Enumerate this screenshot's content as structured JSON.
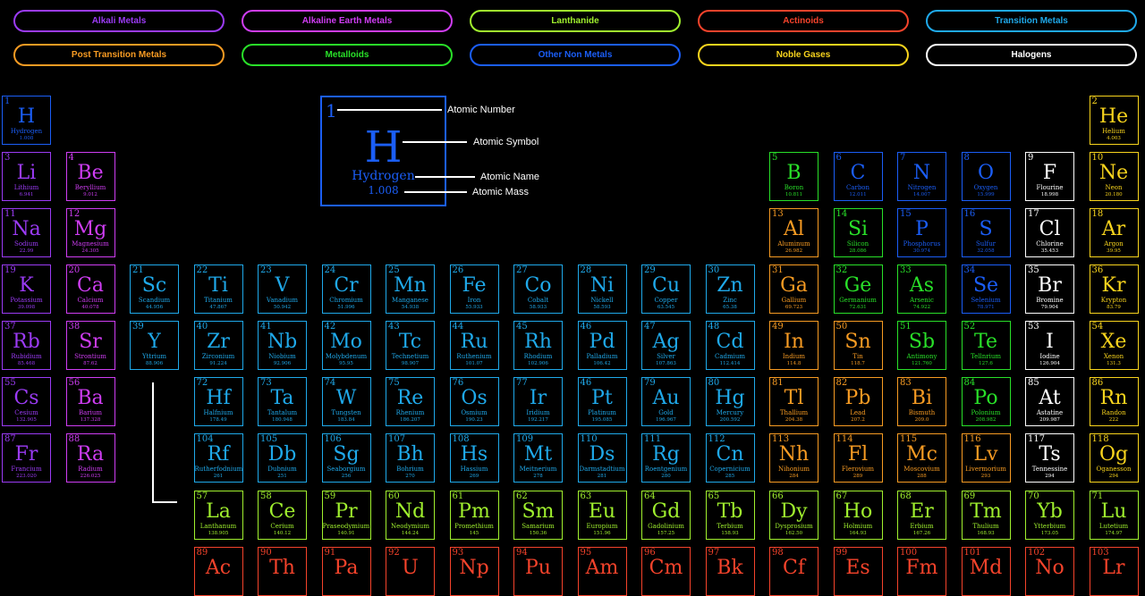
{
  "colors": {
    "alkali": "#9b3bf5",
    "alkaline": "#cf3df3",
    "lanthanide": "#a0f02e",
    "actinoid": "#f5432b",
    "transition": "#1fa9ea",
    "post": "#f79b23",
    "metalloid": "#29e029",
    "nonmetal": "#1b5ef7",
    "noble": "#f8d41d",
    "halogen": "#ffffff"
  },
  "categories": [
    {
      "label": "Alkali Metals",
      "cat": "alkali"
    },
    {
      "label": "Alkaline Earth Metals",
      "cat": "alkaline"
    },
    {
      "label": "Lanthanide",
      "cat": "lanthanide"
    },
    {
      "label": "Actinoids",
      "cat": "actinoid"
    },
    {
      "label": "Transition Metals",
      "cat": "transition"
    },
    {
      "label": "Post Transition Metals",
      "cat": "post"
    },
    {
      "label": "Metalloids",
      "cat": "metalloid"
    },
    {
      "label": "Other Non Metals",
      "cat": "nonmetal"
    },
    {
      "label": "Noble Gases",
      "cat": "noble"
    },
    {
      "label": "Halogens",
      "cat": "halogen"
    }
  ],
  "legend": {
    "number": "1",
    "symbol": "H",
    "name": "Hydrogen",
    "mass": "1.008",
    "labels": {
      "number": "Atomic Number",
      "symbol": "Atomic Symbol",
      "name": "Atomic Name",
      "mass": "Atomic Mass"
    }
  },
  "elements": [
    {
      "n": "1",
      "s": "H",
      "name": "Hydrogen",
      "m": "1.008",
      "c": "nonmetal",
      "col": 1,
      "row": 1
    },
    {
      "n": "2",
      "s": "He",
      "name": "Helium",
      "m": "4.003",
      "c": "noble",
      "col": 18,
      "row": 1
    },
    {
      "n": "3",
      "s": "Li",
      "name": "Lithium",
      "m": "6.941",
      "c": "alkali",
      "col": 1,
      "row": 2
    },
    {
      "n": "4",
      "s": "Be",
      "name": "Beryllium",
      "m": "9.012",
      "c": "alkaline",
      "col": 2,
      "row": 2
    },
    {
      "n": "5",
      "s": "B",
      "name": "Boron",
      "m": "10.811",
      "c": "metalloid",
      "col": 13,
      "row": 2
    },
    {
      "n": "6",
      "s": "C",
      "name": "Carbon",
      "m": "12.011",
      "c": "nonmetal",
      "col": 14,
      "row": 2
    },
    {
      "n": "7",
      "s": "N",
      "name": "Nitrogen",
      "m": "14.007",
      "c": "nonmetal",
      "col": 15,
      "row": 2
    },
    {
      "n": "8",
      "s": "O",
      "name": "Oxygen",
      "m": "15.999",
      "c": "nonmetal",
      "col": 16,
      "row": 2
    },
    {
      "n": "9",
      "s": "F",
      "name": "Flourine",
      "m": "18.998",
      "c": "halogen",
      "col": 17,
      "row": 2
    },
    {
      "n": "10",
      "s": "Ne",
      "name": "Neon",
      "m": "20.180",
      "c": "noble",
      "col": 18,
      "row": 2
    },
    {
      "n": "11",
      "s": "Na",
      "name": "Sodium",
      "m": "22.99",
      "c": "alkali",
      "col": 1,
      "row": 3
    },
    {
      "n": "12",
      "s": "Mg",
      "name": "Magnesium",
      "m": "24.305",
      "c": "alkaline",
      "col": 2,
      "row": 3
    },
    {
      "n": "13",
      "s": "Al",
      "name": "Aluminum",
      "m": "26.982",
      "c": "post",
      "col": 13,
      "row": 3
    },
    {
      "n": "14",
      "s": "Si",
      "name": "Silicon",
      "m": "28.086",
      "c": "metalloid",
      "col": 14,
      "row": 3
    },
    {
      "n": "15",
      "s": "P",
      "name": "Phosphorus",
      "m": "30.974",
      "c": "nonmetal",
      "col": 15,
      "row": 3
    },
    {
      "n": "16",
      "s": "S",
      "name": "Sulfur",
      "m": "32.058",
      "c": "nonmetal",
      "col": 16,
      "row": 3
    },
    {
      "n": "17",
      "s": "Cl",
      "name": "Chlorine",
      "m": "35.453",
      "c": "halogen",
      "col": 17,
      "row": 3
    },
    {
      "n": "18",
      "s": "Ar",
      "name": "Argon",
      "m": "39.95",
      "c": "noble",
      "col": 18,
      "row": 3
    },
    {
      "n": "19",
      "s": "K",
      "name": "Potassium",
      "m": "39.098",
      "c": "alkali",
      "col": 1,
      "row": 4
    },
    {
      "n": "20",
      "s": "Ca",
      "name": "Calcium",
      "m": "40.078",
      "c": "alkaline",
      "col": 2,
      "row": 4
    },
    {
      "n": "21",
      "s": "Sc",
      "name": "Scandium",
      "m": "44.956",
      "c": "transition",
      "col": 3,
      "row": 4
    },
    {
      "n": "22",
      "s": "Ti",
      "name": "Titanium",
      "m": "47.867",
      "c": "transition",
      "col": 4,
      "row": 4
    },
    {
      "n": "23",
      "s": "V",
      "name": "Vanadium",
      "m": "50.942",
      "c": "transition",
      "col": 5,
      "row": 4
    },
    {
      "n": "24",
      "s": "Cr",
      "name": "Chromium",
      "m": "51.996",
      "c": "transition",
      "col": 6,
      "row": 4
    },
    {
      "n": "25",
      "s": "Mn",
      "name": "Manganese",
      "m": "54.938",
      "c": "transition",
      "col": 7,
      "row": 4
    },
    {
      "n": "26",
      "s": "Fe",
      "name": "Iron",
      "m": "55.933",
      "c": "transition",
      "col": 8,
      "row": 4
    },
    {
      "n": "27",
      "s": "Co",
      "name": "Cobalt",
      "m": "58.933",
      "c": "transition",
      "col": 9,
      "row": 4
    },
    {
      "n": "28",
      "s": "Ni",
      "name": "Nickell",
      "m": "58.593",
      "c": "transition",
      "col": 10,
      "row": 4
    },
    {
      "n": "29",
      "s": "Cu",
      "name": "Copper",
      "m": "63.545",
      "c": "transition",
      "col": 11,
      "row": 4
    },
    {
      "n": "30",
      "s": "Zn",
      "name": "Zinc",
      "m": "65.38",
      "c": "transition",
      "col": 12,
      "row": 4
    },
    {
      "n": "31",
      "s": "Ga",
      "name": "Gallium",
      "m": "69.723",
      "c": "post",
      "col": 13,
      "row": 4
    },
    {
      "n": "32",
      "s": "Ge",
      "name": "Germanium",
      "m": "72.631",
      "c": "metalloid",
      "col": 14,
      "row": 4
    },
    {
      "n": "33",
      "s": "As",
      "name": "Arsenic",
      "m": "74.922",
      "c": "metalloid",
      "col": 15,
      "row": 4
    },
    {
      "n": "34",
      "s": "Se",
      "name": "Selenium",
      "m": "78.971",
      "c": "nonmetal",
      "col": 16,
      "row": 4
    },
    {
      "n": "35",
      "s": "Br",
      "name": "Bromine",
      "m": "79.904",
      "c": "halogen",
      "col": 17,
      "row": 4
    },
    {
      "n": "36",
      "s": "Kr",
      "name": "Krypton",
      "m": "83.79",
      "c": "noble",
      "col": 18,
      "row": 4
    },
    {
      "n": "37",
      "s": "Rb",
      "name": "Rubidium",
      "m": "85.468",
      "c": "alkali",
      "col": 1,
      "row": 5
    },
    {
      "n": "38",
      "s": "Sr",
      "name": "Strontium",
      "m": "87.62",
      "c": "alkaline",
      "col": 2,
      "row": 5
    },
    {
      "n": "39",
      "s": "Y",
      "name": "Yttrium",
      "m": "88.906",
      "c": "transition",
      "col": 3,
      "row": 5
    },
    {
      "n": "40",
      "s": "Zr",
      "name": "Zirconium",
      "m": "91.224",
      "c": "transition",
      "col": 4,
      "row": 5
    },
    {
      "n": "41",
      "s": "Nb",
      "name": "Niobium",
      "m": "92.906",
      "c": "transition",
      "col": 5,
      "row": 5
    },
    {
      "n": "42",
      "s": "Mo",
      "name": "Molybdenum",
      "m": "95.95",
      "c": "transition",
      "col": 6,
      "row": 5
    },
    {
      "n": "43",
      "s": "Tc",
      "name": "Technetium",
      "m": "98.907",
      "c": "transition",
      "col": 7,
      "row": 5
    },
    {
      "n": "44",
      "s": "Ru",
      "name": "Ruthenium",
      "m": "101.07",
      "c": "transition",
      "col": 8,
      "row": 5
    },
    {
      "n": "45",
      "s": "Rh",
      "name": "Rhodium",
      "m": "102.906",
      "c": "transition",
      "col": 9,
      "row": 5
    },
    {
      "n": "46",
      "s": "Pd",
      "name": "Palladium",
      "m": "106.42",
      "c": "transition",
      "col": 10,
      "row": 5
    },
    {
      "n": "47",
      "s": "Ag",
      "name": "Silver",
      "m": "107.863",
      "c": "transition",
      "col": 11,
      "row": 5
    },
    {
      "n": "48",
      "s": "Cd",
      "name": "Cadmium",
      "m": "112.414",
      "c": "transition",
      "col": 12,
      "row": 5
    },
    {
      "n": "49",
      "s": "In",
      "name": "Indium",
      "m": "114.8",
      "c": "post",
      "col": 13,
      "row": 5
    },
    {
      "n": "50",
      "s": "Sn",
      "name": "Tin",
      "m": "118.7",
      "c": "post",
      "col": 14,
      "row": 5
    },
    {
      "n": "51",
      "s": "Sb",
      "name": "Antimony",
      "m": "121.760",
      "c": "metalloid",
      "col": 15,
      "row": 5
    },
    {
      "n": "52",
      "s": "Te",
      "name": "Tellnrium",
      "m": "127.6",
      "c": "metalloid",
      "col": 16,
      "row": 5
    },
    {
      "n": "53",
      "s": "I",
      "name": "Iodine",
      "m": "126.904",
      "c": "halogen",
      "col": 17,
      "row": 5
    },
    {
      "n": "54",
      "s": "Xe",
      "name": "Xenon",
      "m": "131.3",
      "c": "noble",
      "col": 18,
      "row": 5
    },
    {
      "n": "55",
      "s": "Cs",
      "name": "Cesium",
      "m": "132.905",
      "c": "alkali",
      "col": 1,
      "row": 6
    },
    {
      "n": "56",
      "s": "Ba",
      "name": "Barium",
      "m": "137.328",
      "c": "alkaline",
      "col": 2,
      "row": 6
    },
    {
      "n": "72",
      "s": "Hf",
      "name": "Halfnium",
      "m": "178.49",
      "c": "transition",
      "col": 4,
      "row": 6
    },
    {
      "n": "73",
      "s": "Ta",
      "name": "Tantalum",
      "m": "180.948",
      "c": "transition",
      "col": 5,
      "row": 6
    },
    {
      "n": "74",
      "s": "W",
      "name": "Tungsten",
      "m": "183.84",
      "c": "transition",
      "col": 6,
      "row": 6
    },
    {
      "n": "75",
      "s": "Re",
      "name": "Rhenium",
      "m": "186.207",
      "c": "transition",
      "col": 7,
      "row": 6
    },
    {
      "n": "76",
      "s": "Os",
      "name": "Osmium",
      "m": "190.23",
      "c": "transition",
      "col": 8,
      "row": 6
    },
    {
      "n": "77",
      "s": "Ir",
      "name": "Iridium",
      "m": "192.217",
      "c": "transition",
      "col": 9,
      "row": 6
    },
    {
      "n": "46",
      "s": "Pt",
      "name": "Platinum",
      "m": "195.085",
      "c": "transition",
      "col": 10,
      "row": 6
    },
    {
      "n": "79",
      "s": "Au",
      "name": "Gold",
      "m": "196.967",
      "c": "transition",
      "col": 11,
      "row": 6
    },
    {
      "n": "80",
      "s": "Hg",
      "name": "Mercury",
      "m": "200.592",
      "c": "transition",
      "col": 12,
      "row": 6
    },
    {
      "n": "81",
      "s": "Tl",
      "name": "Thallium",
      "m": "204.38",
      "c": "post",
      "col": 13,
      "row": 6
    },
    {
      "n": "82",
      "s": "Pb",
      "name": "Lead",
      "m": "207.2",
      "c": "post",
      "col": 14,
      "row": 6
    },
    {
      "n": "83",
      "s": "Bi",
      "name": "Bismuth",
      "m": "209.0",
      "c": "post",
      "col": 15,
      "row": 6
    },
    {
      "n": "84",
      "s": "Po",
      "name": "Polonium",
      "m": "208.982",
      "c": "metalloid",
      "col": 16,
      "row": 6
    },
    {
      "n": "85",
      "s": "At",
      "name": "Astatine",
      "m": "209.987",
      "c": "halogen",
      "col": 17,
      "row": 6
    },
    {
      "n": "86",
      "s": "Rn",
      "name": "Randon",
      "m": "222",
      "c": "noble",
      "col": 18,
      "row": 6
    },
    {
      "n": "87",
      "s": "Fr",
      "name": "Francium",
      "m": "223.020",
      "c": "alkali",
      "col": 1,
      "row": 7
    },
    {
      "n": "88",
      "s": "Ra",
      "name": "Radium",
      "m": "226.025",
      "c": "alkaline",
      "col": 2,
      "row": 7
    },
    {
      "n": "104",
      "s": "Rf",
      "name": "Rutherfodnium",
      "m": "261",
      "c": "transition",
      "col": 4,
      "row": 7
    },
    {
      "n": "105",
      "s": "Db",
      "name": "Dubnium",
      "m": "251",
      "c": "transition",
      "col": 5,
      "row": 7
    },
    {
      "n": "106",
      "s": "Sg",
      "name": "Seaborgium",
      "m": "256",
      "c": "transition",
      "col": 6,
      "row": 7
    },
    {
      "n": "107",
      "s": "Bh",
      "name": "Bohrium",
      "m": "270",
      "c": "transition",
      "col": 7,
      "row": 7
    },
    {
      "n": "108",
      "s": "Hs",
      "name": "Hassium",
      "m": "269",
      "c": "transition",
      "col": 8,
      "row": 7
    },
    {
      "n": "109",
      "s": "Mt",
      "name": "Meitnerium",
      "m": "278",
      "c": "transition",
      "col": 9,
      "row": 7
    },
    {
      "n": "110",
      "s": "Ds",
      "name": "Darmstadtium",
      "m": "281",
      "c": "transition",
      "col": 10,
      "row": 7
    },
    {
      "n": "111",
      "s": "Rg",
      "name": "Roentgenium",
      "m": "280",
      "c": "transition",
      "col": 11,
      "row": 7
    },
    {
      "n": "112",
      "s": "Cn",
      "name": "Copernicium",
      "m": "285",
      "c": "transition",
      "col": 12,
      "row": 7
    },
    {
      "n": "113",
      "s": "Nh",
      "name": "Nihonium",
      "m": "284",
      "c": "post",
      "col": 13,
      "row": 7
    },
    {
      "n": "114",
      "s": "Fl",
      "name": "Flerovium",
      "m": "289",
      "c": "post",
      "col": 14,
      "row": 7
    },
    {
      "n": "115",
      "s": "Mc",
      "name": "Moscovium",
      "m": "288",
      "c": "post",
      "col": 15,
      "row": 7
    },
    {
      "n": "116",
      "s": "Lv",
      "name": "Livermorium",
      "m": "293",
      "c": "post",
      "col": 16,
      "row": 7
    },
    {
      "n": "117",
      "s": "Ts",
      "name": "Tennessine",
      "m": "294",
      "c": "halogen",
      "col": 17,
      "row": 7
    },
    {
      "n": "118",
      "s": "Og",
      "name": "Oganesson",
      "m": "294",
      "c": "noble",
      "col": 18,
      "row": 7
    },
    {
      "n": "57",
      "s": "La",
      "name": "Lanthanum",
      "m": "138.905",
      "c": "lanthanide",
      "col": 4,
      "row": 8
    },
    {
      "n": "58",
      "s": "Ce",
      "name": "Cerium",
      "m": "140.12",
      "c": "lanthanide",
      "col": 5,
      "row": 8
    },
    {
      "n": "59",
      "s": "Pr",
      "name": "Praseodymium",
      "m": "140.91",
      "c": "lanthanide",
      "col": 6,
      "row": 8
    },
    {
      "n": "60",
      "s": "Nd",
      "name": "Neodymium",
      "m": "144.24",
      "c": "lanthanide",
      "col": 7,
      "row": 8
    },
    {
      "n": "61",
      "s": "Pm",
      "name": "Promethium",
      "m": "145",
      "c": "lanthanide",
      "col": 8,
      "row": 8
    },
    {
      "n": "62",
      "s": "Sm",
      "name": "Samarium",
      "m": "150.36",
      "c": "lanthanide",
      "col": 9,
      "row": 8
    },
    {
      "n": "63",
      "s": "Eu",
      "name": "Europium",
      "m": "151.96",
      "c": "lanthanide",
      "col": 10,
      "row": 8
    },
    {
      "n": "64",
      "s": "Gd",
      "name": "Gadolinium",
      "m": "157.25",
      "c": "lanthanide",
      "col": 11,
      "row": 8
    },
    {
      "n": "65",
      "s": "Tb",
      "name": "Terbium",
      "m": "158.93",
      "c": "lanthanide",
      "col": 12,
      "row": 8
    },
    {
      "n": "66",
      "s": "Dy",
      "name": "Dysprosium",
      "m": "162.50",
      "c": "lanthanide",
      "col": 13,
      "row": 8
    },
    {
      "n": "67",
      "s": "Ho",
      "name": "Holmium",
      "m": "164.93",
      "c": "lanthanide",
      "col": 14,
      "row": 8
    },
    {
      "n": "68",
      "s": "Er",
      "name": "Erbium",
      "m": "167.26",
      "c": "lanthanide",
      "col": 15,
      "row": 8
    },
    {
      "n": "69",
      "s": "Tm",
      "name": "Thulium",
      "m": "168.93",
      "c": "lanthanide",
      "col": 16,
      "row": 8
    },
    {
      "n": "70",
      "s": "Yb",
      "name": "Ytterbium",
      "m": "173.05",
      "c": "lanthanide",
      "col": 17,
      "row": 8
    },
    {
      "n": "71",
      "s": "Lu",
      "name": "Lutetium",
      "m": "174.97",
      "c": "lanthanide",
      "col": 18,
      "row": 8
    },
    {
      "n": "89",
      "s": "Ac",
      "name": "",
      "m": "",
      "c": "actinoid",
      "col": 4,
      "row": 9
    },
    {
      "n": "90",
      "s": "Th",
      "name": "",
      "m": "",
      "c": "actinoid",
      "col": 5,
      "row": 9
    },
    {
      "n": "91",
      "s": "Pa",
      "name": "",
      "m": "",
      "c": "actinoid",
      "col": 6,
      "row": 9
    },
    {
      "n": "92",
      "s": "U",
      "name": "",
      "m": "",
      "c": "actinoid",
      "col": 7,
      "row": 9
    },
    {
      "n": "93",
      "s": "Np",
      "name": "",
      "m": "",
      "c": "actinoid",
      "col": 8,
      "row": 9
    },
    {
      "n": "94",
      "s": "Pu",
      "name": "",
      "m": "",
      "c": "actinoid",
      "col": 9,
      "row": 9
    },
    {
      "n": "95",
      "s": "Am",
      "name": "",
      "m": "",
      "c": "actinoid",
      "col": 10,
      "row": 9
    },
    {
      "n": "96",
      "s": "Cm",
      "name": "",
      "m": "",
      "c": "actinoid",
      "col": 11,
      "row": 9
    },
    {
      "n": "97",
      "s": "Bk",
      "name": "",
      "m": "",
      "c": "actinoid",
      "col": 12,
      "row": 9
    },
    {
      "n": "98",
      "s": "Cf",
      "name": "",
      "m": "",
      "c": "actinoid",
      "col": 13,
      "row": 9
    },
    {
      "n": "99",
      "s": "Es",
      "name": "",
      "m": "",
      "c": "actinoid",
      "col": 14,
      "row": 9
    },
    {
      "n": "100",
      "s": "Fm",
      "name": "",
      "m": "",
      "c": "actinoid",
      "col": 15,
      "row": 9
    },
    {
      "n": "101",
      "s": "Md",
      "name": "",
      "m": "",
      "c": "actinoid",
      "col": 16,
      "row": 9
    },
    {
      "n": "102",
      "s": "No",
      "name": "",
      "m": "",
      "c": "actinoid",
      "col": 17,
      "row": 9
    },
    {
      "n": "103",
      "s": "Lr",
      "name": "",
      "m": "",
      "c": "actinoid",
      "col": 18,
      "row": 9
    }
  ]
}
